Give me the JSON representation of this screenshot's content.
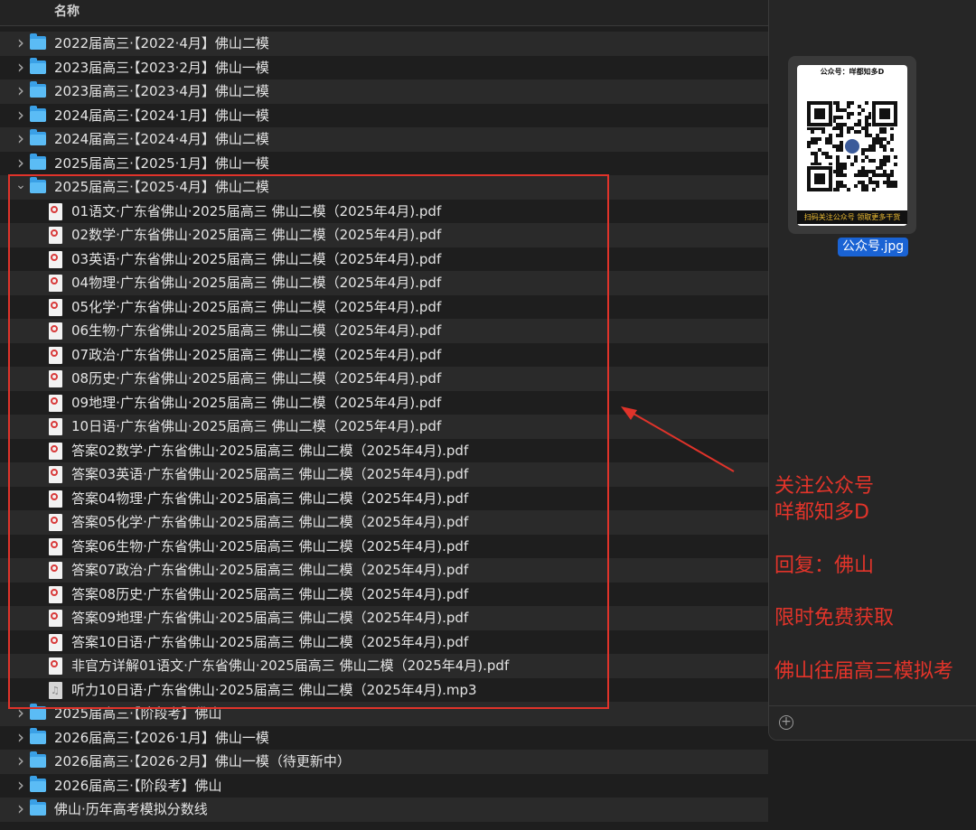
{
  "header": {
    "column_name": "名称"
  },
  "rows": [
    {
      "type": "folder",
      "expanded": false,
      "name": "2022届高三·【2022·4月】佛山二模"
    },
    {
      "type": "folder",
      "expanded": false,
      "name": "2023届高三·【2023·2月】佛山一模"
    },
    {
      "type": "folder",
      "expanded": false,
      "name": "2023届高三·【2023·4月】佛山二模"
    },
    {
      "type": "folder",
      "expanded": false,
      "name": "2024届高三·【2024·1月】佛山一模"
    },
    {
      "type": "folder",
      "expanded": false,
      "name": "2024届高三·【2024·4月】佛山二模"
    },
    {
      "type": "folder",
      "expanded": false,
      "name": "2025届高三·【2025·1月】佛山一模"
    },
    {
      "type": "folder",
      "expanded": true,
      "name": "2025届高三·【2025·4月】佛山二模"
    },
    {
      "type": "pdf",
      "name": "01语文·广东省佛山·2025届高三 佛山二模（2025年4月).pdf"
    },
    {
      "type": "pdf",
      "name": "02数学·广东省佛山·2025届高三 佛山二模（2025年4月).pdf"
    },
    {
      "type": "pdf",
      "name": "03英语·广东省佛山·2025届高三 佛山二模（2025年4月).pdf"
    },
    {
      "type": "pdf",
      "name": "04物理·广东省佛山·2025届高三 佛山二模（2025年4月).pdf"
    },
    {
      "type": "pdf",
      "name": "05化学·广东省佛山·2025届高三 佛山二模（2025年4月).pdf"
    },
    {
      "type": "pdf",
      "name": "06生物·广东省佛山·2025届高三 佛山二模（2025年4月).pdf"
    },
    {
      "type": "pdf",
      "name": "07政治·广东省佛山·2025届高三 佛山二模（2025年4月).pdf"
    },
    {
      "type": "pdf",
      "name": "08历史·广东省佛山·2025届高三 佛山二模（2025年4月).pdf"
    },
    {
      "type": "pdf",
      "name": "09地理·广东省佛山·2025届高三 佛山二模（2025年4月).pdf"
    },
    {
      "type": "pdf",
      "name": "10日语·广东省佛山·2025届高三 佛山二模（2025年4月).pdf"
    },
    {
      "type": "pdf",
      "name": "答案02数学·广东省佛山·2025届高三 佛山二模（2025年4月).pdf"
    },
    {
      "type": "pdf",
      "name": "答案03英语·广东省佛山·2025届高三 佛山二模（2025年4月).pdf"
    },
    {
      "type": "pdf",
      "name": "答案04物理·广东省佛山·2025届高三 佛山二模（2025年4月).pdf"
    },
    {
      "type": "pdf",
      "name": "答案05化学·广东省佛山·2025届高三 佛山二模（2025年4月).pdf"
    },
    {
      "type": "pdf",
      "name": "答案06生物·广东省佛山·2025届高三 佛山二模（2025年4月).pdf"
    },
    {
      "type": "pdf",
      "name": "答案07政治·广东省佛山·2025届高三 佛山二模（2025年4月).pdf"
    },
    {
      "type": "pdf",
      "name": "答案08历史·广东省佛山·2025届高三 佛山二模（2025年4月).pdf"
    },
    {
      "type": "pdf",
      "name": "答案09地理·广东省佛山·2025届高三 佛山二模（2025年4月).pdf"
    },
    {
      "type": "pdf",
      "name": "答案10日语·广东省佛山·2025届高三 佛山二模（2025年4月).pdf"
    },
    {
      "type": "pdf",
      "name": "非官方详解01语文·广东省佛山·2025届高三 佛山二模（2025年4月).pdf"
    },
    {
      "type": "mp3",
      "name": "听力10日语·广东省佛山·2025届高三 佛山二模（2025年4月).mp3"
    },
    {
      "type": "folder",
      "expanded": false,
      "name": "2025届高三·【阶段考】佛山"
    },
    {
      "type": "folder",
      "expanded": false,
      "name": "2026届高三·【2026·1月】佛山一模"
    },
    {
      "type": "folder",
      "expanded": false,
      "name": "2026届高三·【2026·2月】佛山一模（待更新中）"
    },
    {
      "type": "folder",
      "expanded": false,
      "name": "2026届高三·【阶段考】佛山"
    },
    {
      "type": "folder",
      "expanded": false,
      "name": "佛山·历年高考模拟分数线"
    }
  ],
  "preview": {
    "qr_top_text": "公众号：咩都知多D",
    "qr_bottom_text": "扫码关注公众号 领取更多干货",
    "filename": "公众号.jpg",
    "add_symbol": "+"
  },
  "annotation": {
    "lines": [
      "关注公众号",
      "咩都知多D",
      "",
      "回复：佛山",
      "",
      "限时免费获取",
      "",
      "佛山往届高三模拟考"
    ]
  },
  "colors": {
    "highlight": "#e0332a",
    "annotation_text": "#e3342a",
    "folder": "#3aa0e6",
    "selection": "#1a63d4"
  },
  "icons": {
    "folder": "folder-icon",
    "pdf": "pdf-file-icon",
    "mp3": "audio-file-icon",
    "chevron_collapsed": "chevron-right-icon",
    "chevron_expanded": "chevron-down-icon",
    "add": "plus-circle-icon"
  }
}
